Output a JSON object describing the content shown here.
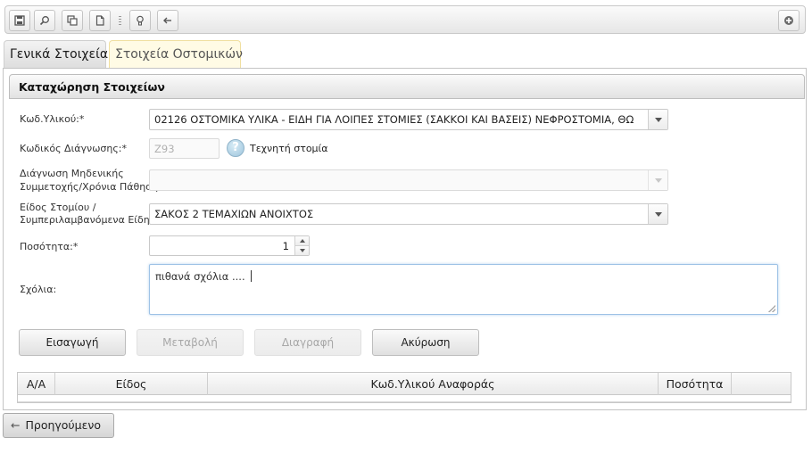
{
  "toolbar": {
    "buttons": [
      {
        "icon": "save-icon"
      },
      {
        "icon": "search-icon"
      },
      {
        "icon": "copy-icon"
      },
      {
        "icon": "document-icon"
      },
      {
        "icon": "lightbulb-icon"
      },
      {
        "icon": "arrow-left-icon"
      }
    ],
    "right_button_icon": "plus-circle-icon"
  },
  "tabs": [
    {
      "label": "Γενικά Στοιχεία",
      "active": true
    },
    {
      "label": "Στοιχεία Οστομικών",
      "active": false
    }
  ],
  "panel": {
    "title": "Καταχώρηση Στοιχείων"
  },
  "form": {
    "material_code_label": "Κωδ.Υλικού:*",
    "material_code_value": "02126 ΟΣΤΟΜΙΚΑ ΥΛΙΚΑ - ΕΙΔΗ ΓΙΑ ΛΟΙΠΕΣ ΣΤΟΜΙΕΣ (ΣΑΚΚΟΙ ΚΑΙ ΒΑΣΕΙΣ) ΝΕΦΡΟΣΤΟΜΙΑ, ΘΩ",
    "diagnosis_code_label": "Κωδικός Διάγνωσης:*",
    "diagnosis_code_value": "Z93",
    "diagnosis_description": "Τεχνητή στομία",
    "zero_participation_label_line1": "Διάγνωση Μηδενικής",
    "zero_participation_label_line2": "Συμμετοχής/Χρόνια Πάθηση",
    "zero_participation_value": "",
    "stoma_type_label_line1": "Είδος Στομίου /",
    "stoma_type_label_line2": "Συμπεριλαμβανόμενα Είδη:*",
    "stoma_type_value": "ΣΑΚΟΣ 2 ΤΕΜΑΧΙΩΝ ΑΝΟΙΧΤΟΣ",
    "quantity_label": "Ποσότητα:*",
    "quantity_value": "1",
    "comments_label": "Σχόλια:",
    "comments_value": "πιθανά σχόλια ...."
  },
  "actions": {
    "insert": "Εισαγωγή",
    "modify": "Μεταβολή",
    "delete": "Διαγραφή",
    "cancel": "Ακύρωση"
  },
  "grid": {
    "columns": [
      "Α/Α",
      "Είδος",
      "Κωδ.Υλικού Αναφοράς",
      "Ποσότητα",
      ""
    ]
  },
  "footer": {
    "previous": "Προηγούμενο"
  }
}
